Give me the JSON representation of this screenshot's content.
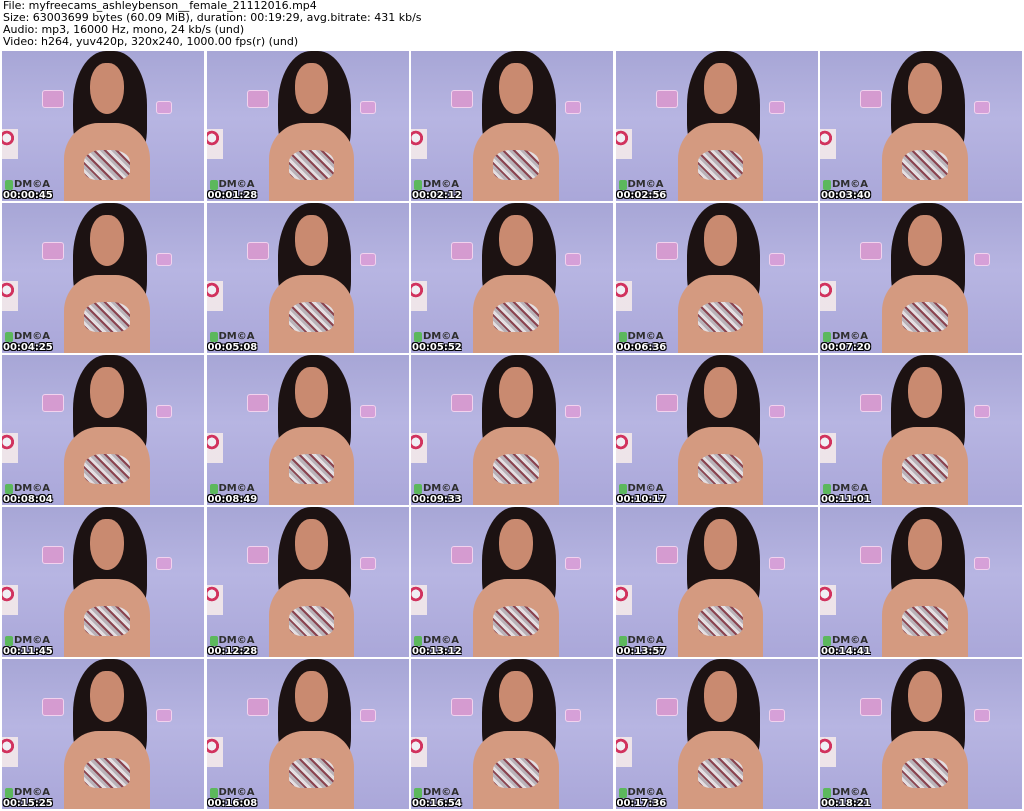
{
  "header": {
    "file": "File: myfreecams_ashleybenson__female_21112016.mp4",
    "size": "Size: 63003699 bytes (60.09 MiB), duration: 00:19:29, avg.bitrate: 431 kb/s",
    "audio": "Audio: mp3, 16000 Hz, mono, 24 kb/s (und)",
    "video": "Video: h264, yuv420p, 320x240, 1000.00 fps(r) (und)"
  },
  "watermark": "DM©A",
  "thumbnails": [
    {
      "timestamp": "00:00:45"
    },
    {
      "timestamp": "00:01:28"
    },
    {
      "timestamp": "00:02:12"
    },
    {
      "timestamp": "00:02:56"
    },
    {
      "timestamp": "00:03:40"
    },
    {
      "timestamp": "00:04:25"
    },
    {
      "timestamp": "00:05:08"
    },
    {
      "timestamp": "00:05:52"
    },
    {
      "timestamp": "00:06:36"
    },
    {
      "timestamp": "00:07:20"
    },
    {
      "timestamp": "00:08:04"
    },
    {
      "timestamp": "00:08:49"
    },
    {
      "timestamp": "00:09:33"
    },
    {
      "timestamp": "00:10:17"
    },
    {
      "timestamp": "00:11:01"
    },
    {
      "timestamp": "00:11:45"
    },
    {
      "timestamp": "00:12:28"
    },
    {
      "timestamp": "00:13:12"
    },
    {
      "timestamp": "00:13:57"
    },
    {
      "timestamp": "00:14:41"
    },
    {
      "timestamp": "00:15:25"
    },
    {
      "timestamp": "00:16:08"
    },
    {
      "timestamp": "00:16:54"
    },
    {
      "timestamp": "00:17:36"
    },
    {
      "timestamp": "00:18:21"
    }
  ]
}
